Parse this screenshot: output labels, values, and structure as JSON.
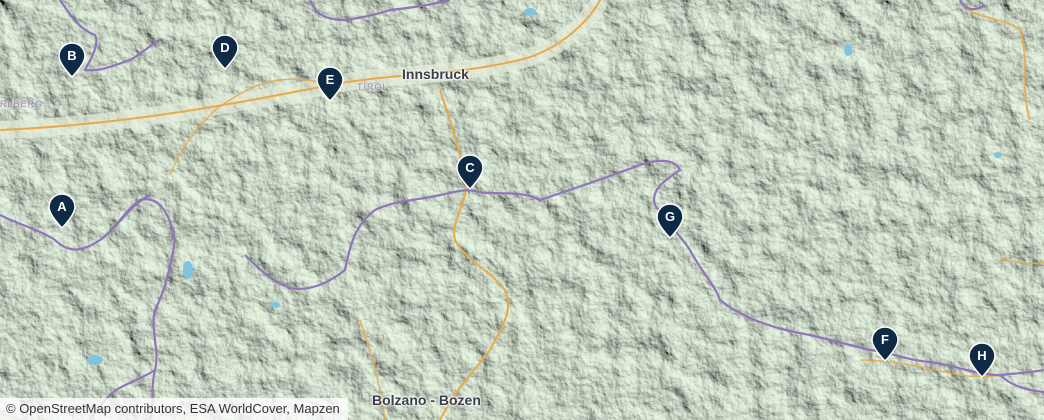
{
  "map": {
    "cities": [
      {
        "id": "innsbruck",
        "label": "Innsbruck"
      },
      {
        "id": "bolzano",
        "label": "Bolzano - Bozen"
      }
    ],
    "regions": [
      {
        "id": "tirol",
        "label": "TIROL"
      },
      {
        "id": "vorarlberg",
        "label": "RLBERG"
      }
    ],
    "markers": [
      {
        "id": "A",
        "letter": "A"
      },
      {
        "id": "B",
        "letter": "B"
      },
      {
        "id": "C",
        "letter": "C"
      },
      {
        "id": "D",
        "letter": "D"
      },
      {
        "id": "E",
        "letter": "E"
      },
      {
        "id": "F",
        "letter": "F"
      },
      {
        "id": "G",
        "letter": "G"
      },
      {
        "id": "H",
        "letter": "H"
      }
    ],
    "attribution": "© OpenStreetMap contributors, ESA WorldCover, Mapzen",
    "colors": {
      "marker": "#0f2a44",
      "border": "#8f76b8",
      "highway": "#e8a94a",
      "water": "#7fc3df",
      "terrain": "#c9dcc2"
    }
  }
}
